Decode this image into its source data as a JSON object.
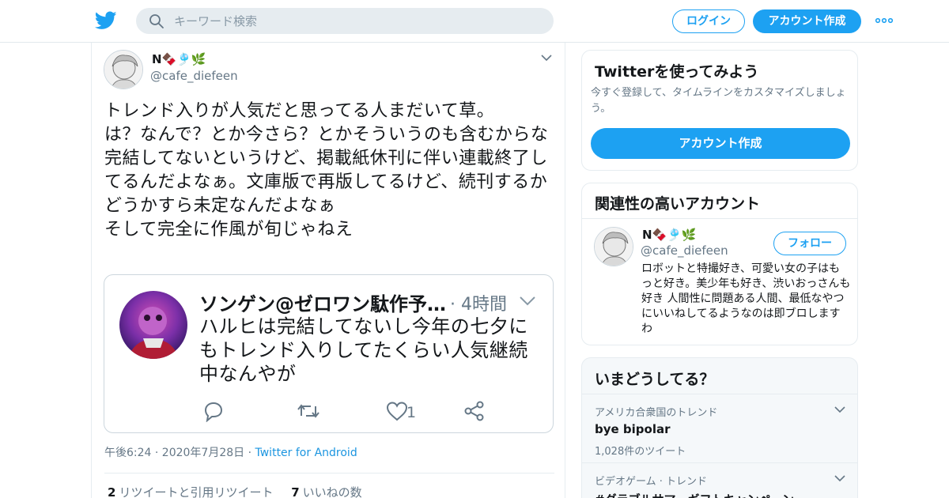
{
  "header": {
    "search_placeholder": "キーワード検索",
    "login_label": "ログイン",
    "signup_label": "アカウント作成",
    "icons": {
      "logo": "twitter-bird-icon",
      "search": "search-icon",
      "more": "more-dots-icon"
    },
    "accent_color": "#1da1f2"
  },
  "tweet": {
    "name": "N🍫🎐🌿",
    "handle": "@cafe_diefeen",
    "text": "トレンド入りが人気だと思ってる人まだいて草。\nは？なんで？とか今さら？とかそういうのも含むからな\n完結してないというけど、掲載紙休刊に伴い連載終了してるんだよなぁ。文庫版で再版してるけど、続刊するかどうかすら未定なんだよなぁ\nそして完全に作風が旬じゃねえ",
    "quote": {
      "name": "ソンゲン@ゼロワン駄作予…",
      "time": "· 4時間",
      "text": "ハルヒは完結してないし今年の七夕にもトレンド入りしてたくらい人気継続中なんやが",
      "like_count": "1"
    },
    "timestamp": "午後6:24 · 2020年7月28日 · ",
    "source": "Twitter for Android",
    "retweets": {
      "count": "2",
      "label": "リツイートと引用リツイート"
    },
    "likes": {
      "count": "7",
      "label": "いいねの数"
    }
  },
  "sidebar": {
    "signup_card": {
      "title": "Twitterを使ってみよう",
      "description": "今すぐ登録して、タイムラインをカスタマイズしましょう。",
      "button_label": "アカウント作成"
    },
    "related_card": {
      "title": "関連性の高いアカウント",
      "name": "N🍫🎐🌿",
      "handle": "@cafe_diefeen",
      "follow_label": "フォロー",
      "bio": "ロボットと特撮好き、可愛い女の子はもっと好き。美少年も好き、渋いおっさんも好き 人間性に問題ある人間、最低なやつにいいねしてるようなのは即ブロしますわ"
    },
    "trends_card": {
      "title": "いまどうしてる？",
      "items": [
        {
          "context": "アメリカ合衆国のトレンド",
          "name": "bye bipolar",
          "count": "1,028件のツイート"
        },
        {
          "context": "ビデオゲーム · トレンド",
          "name": "#グラブルサマーギフトキャンペーン",
          "count": ""
        }
      ]
    }
  }
}
